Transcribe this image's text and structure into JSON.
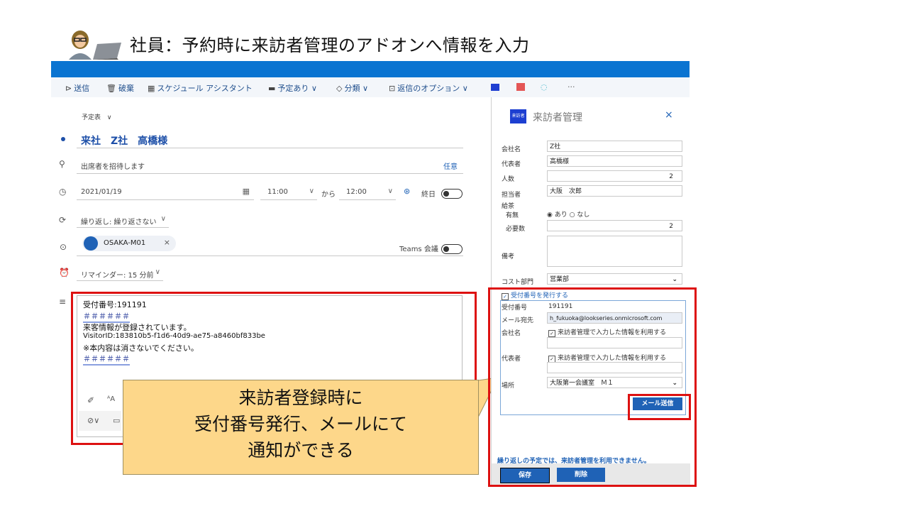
{
  "slide": {
    "title": "社員：予約時に来訪者管理のアドオンへ情報を入力"
  },
  "toolbar": {
    "send": "送信",
    "discard": "破棄",
    "scheduling": "スケジュール アシスタント",
    "busy": "予定あり",
    "categorize": "分類",
    "response": "返信のオプション",
    "more": "···"
  },
  "event": {
    "calendar_label": "予定表",
    "title": "来社　Z社　高橋様",
    "attendees_placeholder": "出席者を招待します",
    "optional": "任意",
    "date": "2021/01/19",
    "start_time": "11:00",
    "to": "から",
    "end_time": "12:00",
    "all_day": "終日",
    "repeat": "繰り返し: 繰り返さない",
    "room": "OSAKA-M01",
    "teams": "Teams 会議",
    "reminder": "リマインダー: 15 分前"
  },
  "body": {
    "line1": "受付番号:191191",
    "hash1": "＃＃＃＃＃＃",
    "line2": "来客情報が登録されています。",
    "line3": "VisitorID:183810b5-f1d6-40d9-ae75-a8460bf833be",
    "line4": "※本内容は消さないでください。",
    "hash2": "＃＃＃＃＃＃"
  },
  "callout": {
    "line1": "来訪者登録時に",
    "line2": "受付番号発行、メールにて",
    "line3": "通知ができる"
  },
  "panel": {
    "logo": "来訪者",
    "title": "来訪者管理",
    "company_label": "会社名",
    "company_value": "Z社",
    "rep_label": "代表者",
    "rep_value": "高橋様",
    "count_label": "人数",
    "count_value": "2",
    "staff_label": "担当者",
    "staff_value": "大阪　次郎",
    "tea_label": "給茶",
    "tea_yesno_label": "有無",
    "tea_yes": "あり",
    "tea_no": "なし",
    "tea_count_label": "必要数",
    "tea_count_value": "2",
    "notes_label": "備考",
    "cost_label": "コスト部門",
    "cost_value": "営業部",
    "issue_label": "受付番号を発行する",
    "rec_no_label": "受付番号",
    "rec_no_value": "191191",
    "mail_label": "メール宛先",
    "mail_value": "h_fukuoka@lookseries.onmicrosoft.com",
    "co_label": "会社名",
    "co_use": "来訪者管理で入力した情報を利用する",
    "rep2_label": "代表者",
    "rep2_use": "来訪者管理で入力した情報を利用する",
    "place_label": "場所",
    "place_value": "大阪第一会議室　Ｍ１",
    "send_mail": "メール送信",
    "repeat_warning": "繰り返しの予定では、来訪者管理を利用できません。",
    "save": "保存",
    "delete": "削除"
  }
}
